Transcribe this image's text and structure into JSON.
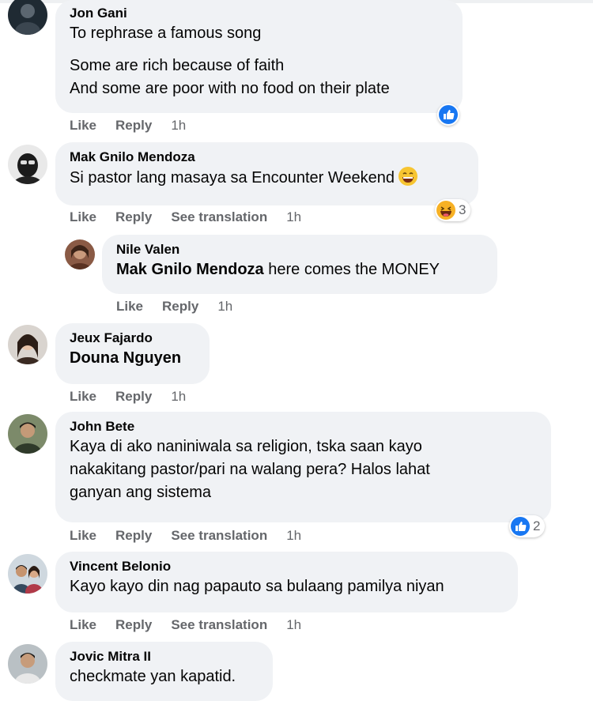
{
  "comments": [
    {
      "name": "Jon Gani",
      "lines": [
        "To rephrase a famous song",
        "Some are rich because of faith",
        "And some are poor with no food on their plate"
      ],
      "actions": {
        "like": "Like",
        "reply": "Reply",
        "time": "1h"
      },
      "reaction": {
        "icon": "like-reaction-icon"
      }
    },
    {
      "name": "Mak Gnilo Mendoza",
      "text": "Si pastor lang masaya sa Encounter Weekend",
      "text_emoji": "grinning-face-icon",
      "actions": {
        "like": "Like",
        "reply": "Reply",
        "translate": "See translation",
        "time": "1h"
      },
      "reaction": {
        "icon": "haha-reaction-icon",
        "count": "3"
      },
      "reply": {
        "name": "Nile Valen",
        "mention": "Mak Gnilo Mendoza",
        "text": "here comes the MONEY",
        "actions": {
          "like": "Like",
          "reply": "Reply",
          "time": "1h"
        }
      }
    },
    {
      "name": "Jeux Fajardo",
      "mention": "Douna Nguyen",
      "actions": {
        "like": "Like",
        "reply": "Reply",
        "time": "1h"
      }
    },
    {
      "name": "John Bete",
      "lines": [
        "Kaya di ako naniniwala sa religion, tska saan kayo",
        "nakakitang pastor/pari na walang pera? Halos lahat",
        "ganyan ang sistema"
      ],
      "actions": {
        "like": "Like",
        "reply": "Reply",
        "translate": "See translation",
        "time": "1h"
      },
      "reaction": {
        "icon": "like-reaction-icon",
        "count": "2"
      }
    },
    {
      "name": "Vincent Belonio",
      "text": "Kayo kayo din nag papauto sa bulaang pamilya niyan",
      "actions": {
        "like": "Like",
        "reply": "Reply",
        "translate": "See translation",
        "time": "1h"
      }
    },
    {
      "name": "Jovic Mitra II",
      "text": "checkmate yan kapatid."
    }
  ],
  "colors": {
    "bubble": "#f0f2f5",
    "meta": "#65676b",
    "like_blue": "#1877f2",
    "haha_yellow": "#f7b125"
  }
}
